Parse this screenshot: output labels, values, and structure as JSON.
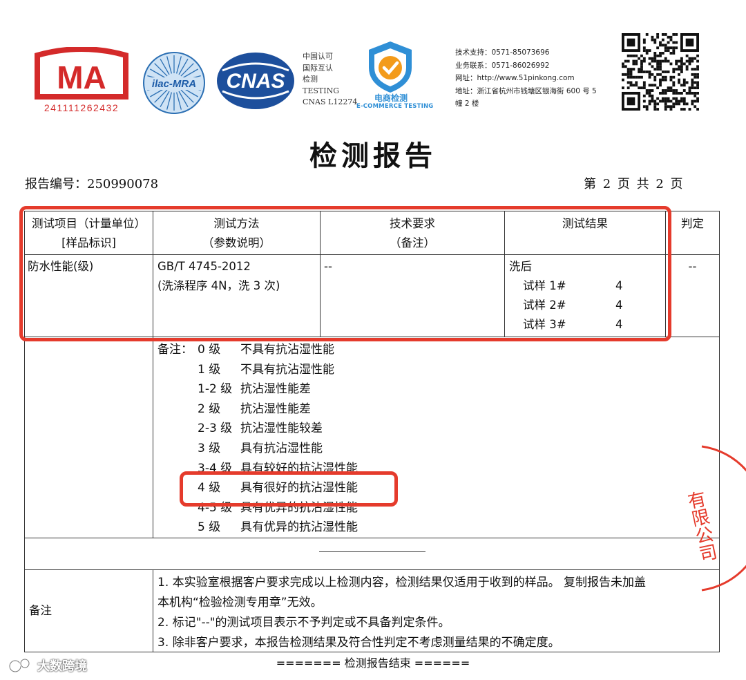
{
  "header": {
    "cma": {
      "letters": "MA",
      "number": "241111262432"
    },
    "ilac_label": "ilac-MRA",
    "cnas_label": "CNAS",
    "cnas_info": [
      "中国认可",
      "国际互认",
      "检测",
      "TESTING",
      "CNAS L12274"
    ],
    "ecommerce": {
      "cn": "电商检测",
      "en": "E-COMMERCE TESTING"
    },
    "contact": [
      "技术支持：0571-85073696",
      "业务联系：0571-86026992",
      "网址：http://www.51pinkong.com",
      "地址：浙江省杭州市钱塘区银海街 600 号 5",
      "幢 2 楼"
    ]
  },
  "report": {
    "title": "检测报告",
    "number_text": "报告编号：250990078",
    "page_text": "第 2 页 共 2 页"
  },
  "table": {
    "headers": {
      "item": [
        "测试项目（计量单位）",
        "[样品标识]"
      ],
      "method": [
        "测试方法",
        "（参数说明）"
      ],
      "requirement": [
        "技术要求",
        "（备注）"
      ],
      "result": [
        "测试结果"
      ],
      "judge": [
        "判定"
      ]
    },
    "row": {
      "item": "防水性能(级)",
      "method": [
        "GB/T  4745-2012",
        "(洗涤程序 4N，洗 3 次)"
      ],
      "requirement": "--",
      "result_title": "洗后",
      "samples": [
        {
          "name": "试样 1#",
          "value": "4"
        },
        {
          "name": "试样 2#",
          "value": "4"
        },
        {
          "name": "试样 3#",
          "value": "4"
        }
      ],
      "judge": "--"
    },
    "notes_prefix": "备注：",
    "ratings": [
      {
        "level": "0 级",
        "desc": "不具有抗沾湿性能"
      },
      {
        "level": "1 级",
        "desc": "不具有抗沾湿性能"
      },
      {
        "level": "1-2 级",
        "desc": "抗沾湿性能差"
      },
      {
        "level": "2 级",
        "desc": "抗沾湿性能差"
      },
      {
        "level": "2-3 级",
        "desc": "抗沾湿性能较差"
      },
      {
        "level": "3 级",
        "desc": "具有抗沾湿性能"
      },
      {
        "level": "3-4 级",
        "desc": "具有较好的抗沾湿性能"
      },
      {
        "level": "4 级",
        "desc": "具有很好的抗沾湿性能"
      },
      {
        "level": "4-5 级",
        "desc": "具有优异的抗沾湿性能"
      },
      {
        "level": "5 级",
        "desc": "具有优异的抗沾湿性能"
      }
    ],
    "remark_label": "备注",
    "remarks": [
      "1.    本实验室根据客户要求完成以上检测内容，检测结果仅适用于收到的样品。 复制报告未加盖",
      "本机构“检验检测专用章”无效。",
      "2.    标记\"--\"的测试项目表示不予判定或不具备判定条件。",
      "3.    除非客户要求，本报告检测结果及符合性判定不考虑测量结果的不确定度。"
    ]
  },
  "footer_end": "======= 检测报告结束 ======",
  "stamp_text": "有限公司",
  "watermark": "大数跨境",
  "colors": {
    "highlight": "#e53b2c",
    "cma": "#d42a2a",
    "ecommerce": "#2f8fd6",
    "cnas": "#1d4f9c"
  }
}
